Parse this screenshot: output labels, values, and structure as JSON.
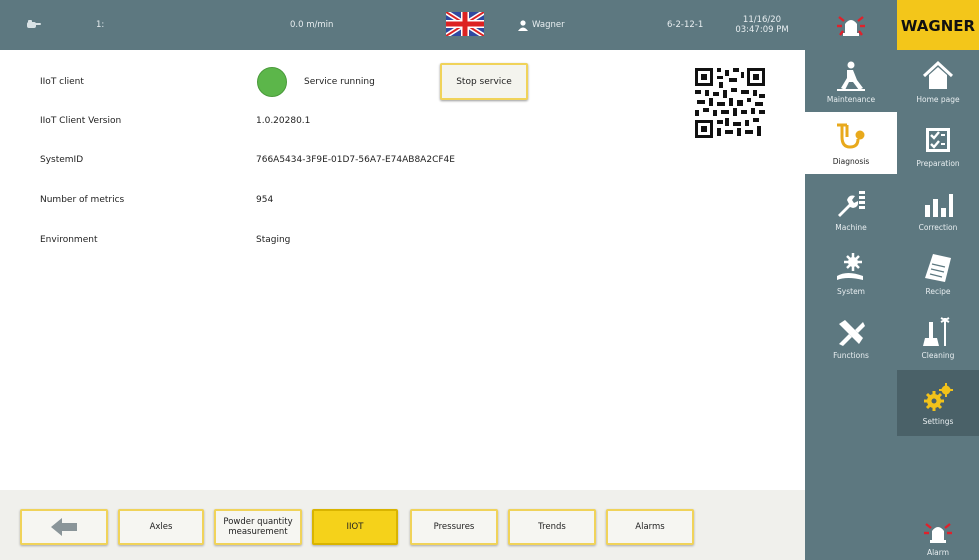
{
  "header": {
    "station": "1:",
    "speed": "0.0 m/min",
    "user": "Wagner",
    "code": "6-2-12-1",
    "date": "11/16/20",
    "time": "03:47:09 PM",
    "logo": "WAGNER",
    "colors": {
      "bar": "#5d7880",
      "logo_bg": "#f3c61a",
      "alarm": "#e0212b"
    }
  },
  "main": {
    "rows": [
      {
        "label": "IIoT client",
        "value": ""
      },
      {
        "label": "IIoT Client Version",
        "value": "1.0.20280.1"
      },
      {
        "label": "SystemID",
        "value": "766A5434-3F9E-01D7-56A7-E74AB8A2CF4E"
      },
      {
        "label": "Number of metrics",
        "value": "954"
      },
      {
        "label": "Environment",
        "value": "Staging"
      }
    ],
    "status_text": "Service running",
    "status_color": "#5cb64a",
    "stop_button": "Stop service"
  },
  "bottom": {
    "buttons": [
      "Axles",
      "Powder quantity measurement",
      "IIOT",
      "Pressures",
      "Trends",
      "Alarms"
    ],
    "active": "IIOT"
  },
  "menu_left": {
    "items": [
      {
        "label": "Maintenance",
        "icon": "maintenance-icon"
      },
      {
        "label": "Diagnosis",
        "icon": "stethoscope-icon"
      },
      {
        "label": "Machine",
        "icon": "wrench-icon"
      },
      {
        "label": "System",
        "icon": "gear-wrench-icon"
      },
      {
        "label": "Functions",
        "icon": "tools-icon"
      }
    ],
    "active": "Diagnosis"
  },
  "menu_right": {
    "items": [
      {
        "label": "Home page",
        "icon": "home-icon"
      },
      {
        "label": "Preparation",
        "icon": "checklist-icon"
      },
      {
        "label": "Correction",
        "icon": "bar-chart-icon"
      },
      {
        "label": "Recipe",
        "icon": "notepad-icon"
      },
      {
        "label": "Cleaning",
        "icon": "cleaning-icon"
      },
      {
        "label": "Settings",
        "icon": "gears-icon"
      }
    ],
    "alarm_label": "Alarm",
    "active": "Settings"
  }
}
